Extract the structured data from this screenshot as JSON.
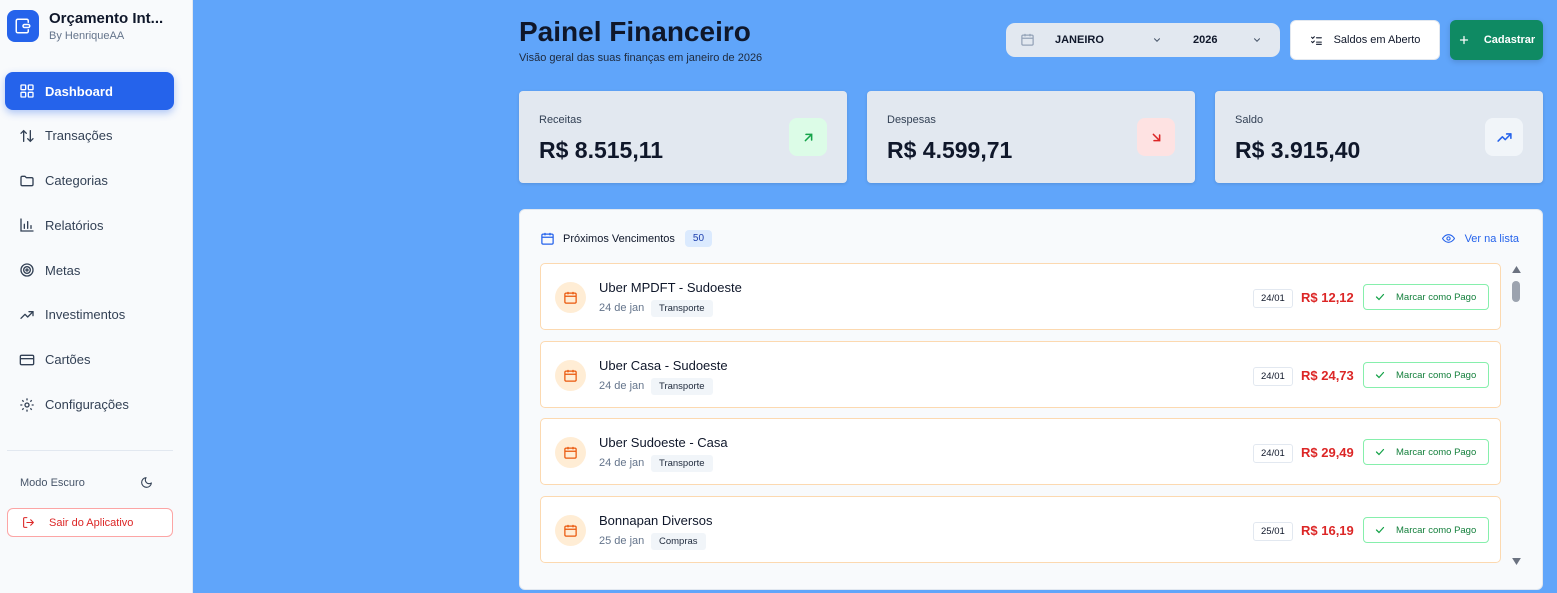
{
  "brand": {
    "title": "Orçamento Int...",
    "subtitle": "By HenriqueAA"
  },
  "sidebar": {
    "items": [
      {
        "label": "Dashboard",
        "icon": "dashboard-icon",
        "active": true
      },
      {
        "label": "Transações",
        "icon": "arrows-up-down-icon",
        "active": false
      },
      {
        "label": "Categorias",
        "icon": "folder-icon",
        "active": false
      },
      {
        "label": "Relatórios",
        "icon": "bar-chart-icon",
        "active": false
      },
      {
        "label": "Metas",
        "icon": "target-icon",
        "active": false
      },
      {
        "label": "Investimentos",
        "icon": "trending-up-icon",
        "active": false
      },
      {
        "label": "Cartões",
        "icon": "credit-card-icon",
        "active": false
      },
      {
        "label": "Configurações",
        "icon": "gear-icon",
        "active": false
      }
    ],
    "dark_mode_label": "Modo Escuro",
    "logout_label": "Sair do Aplicativo"
  },
  "header": {
    "title": "Painel Financeiro",
    "subtitle": "Visão geral das suas finanças em janeiro de 2026",
    "month": "JANEIRO",
    "year": "2026",
    "open_balances_label": "Saldos em Aberto",
    "add_label": "Cadastrar"
  },
  "stats": [
    {
      "label": "Receitas",
      "value": "R$ 8.515,11",
      "icon": "arrow-up-right-icon",
      "color": "#16a34a"
    },
    {
      "label": "Despesas",
      "value": "R$ 4.599,71",
      "icon": "arrow-down-right-icon",
      "color": "#dc2626"
    },
    {
      "label": "Saldo",
      "value": "R$ 3.915,40",
      "icon": "trending-up-icon",
      "color": "#2563eb"
    }
  ],
  "upcoming": {
    "title": "Próximos Vencimentos",
    "count": "50",
    "see_list_label": "Ver na lista",
    "items": [
      {
        "name": "Uber MPDFT - Sudoeste",
        "date": "24 de jan",
        "category": "Transporte",
        "day": "24/01",
        "amount": "R$ 12,12",
        "action": "Marcar como Pago"
      },
      {
        "name": "Uber Casa - Sudoeste",
        "date": "24 de jan",
        "category": "Transporte",
        "day": "24/01",
        "amount": "R$ 24,73",
        "action": "Marcar como Pago"
      },
      {
        "name": "Uber Sudoeste - Casa",
        "date": "24 de jan",
        "category": "Transporte",
        "day": "24/01",
        "amount": "R$ 29,49",
        "action": "Marcar como Pago"
      },
      {
        "name": "Bonnapan Diversos",
        "date": "25 de jan",
        "category": "Compras",
        "day": "25/01",
        "amount": "R$ 16,19",
        "action": "Marcar como Pago"
      }
    ]
  },
  "colors": {
    "primary": "#2563eb",
    "success": "#0f8a63",
    "danger": "#dc2626",
    "background": "#60a5fa"
  }
}
